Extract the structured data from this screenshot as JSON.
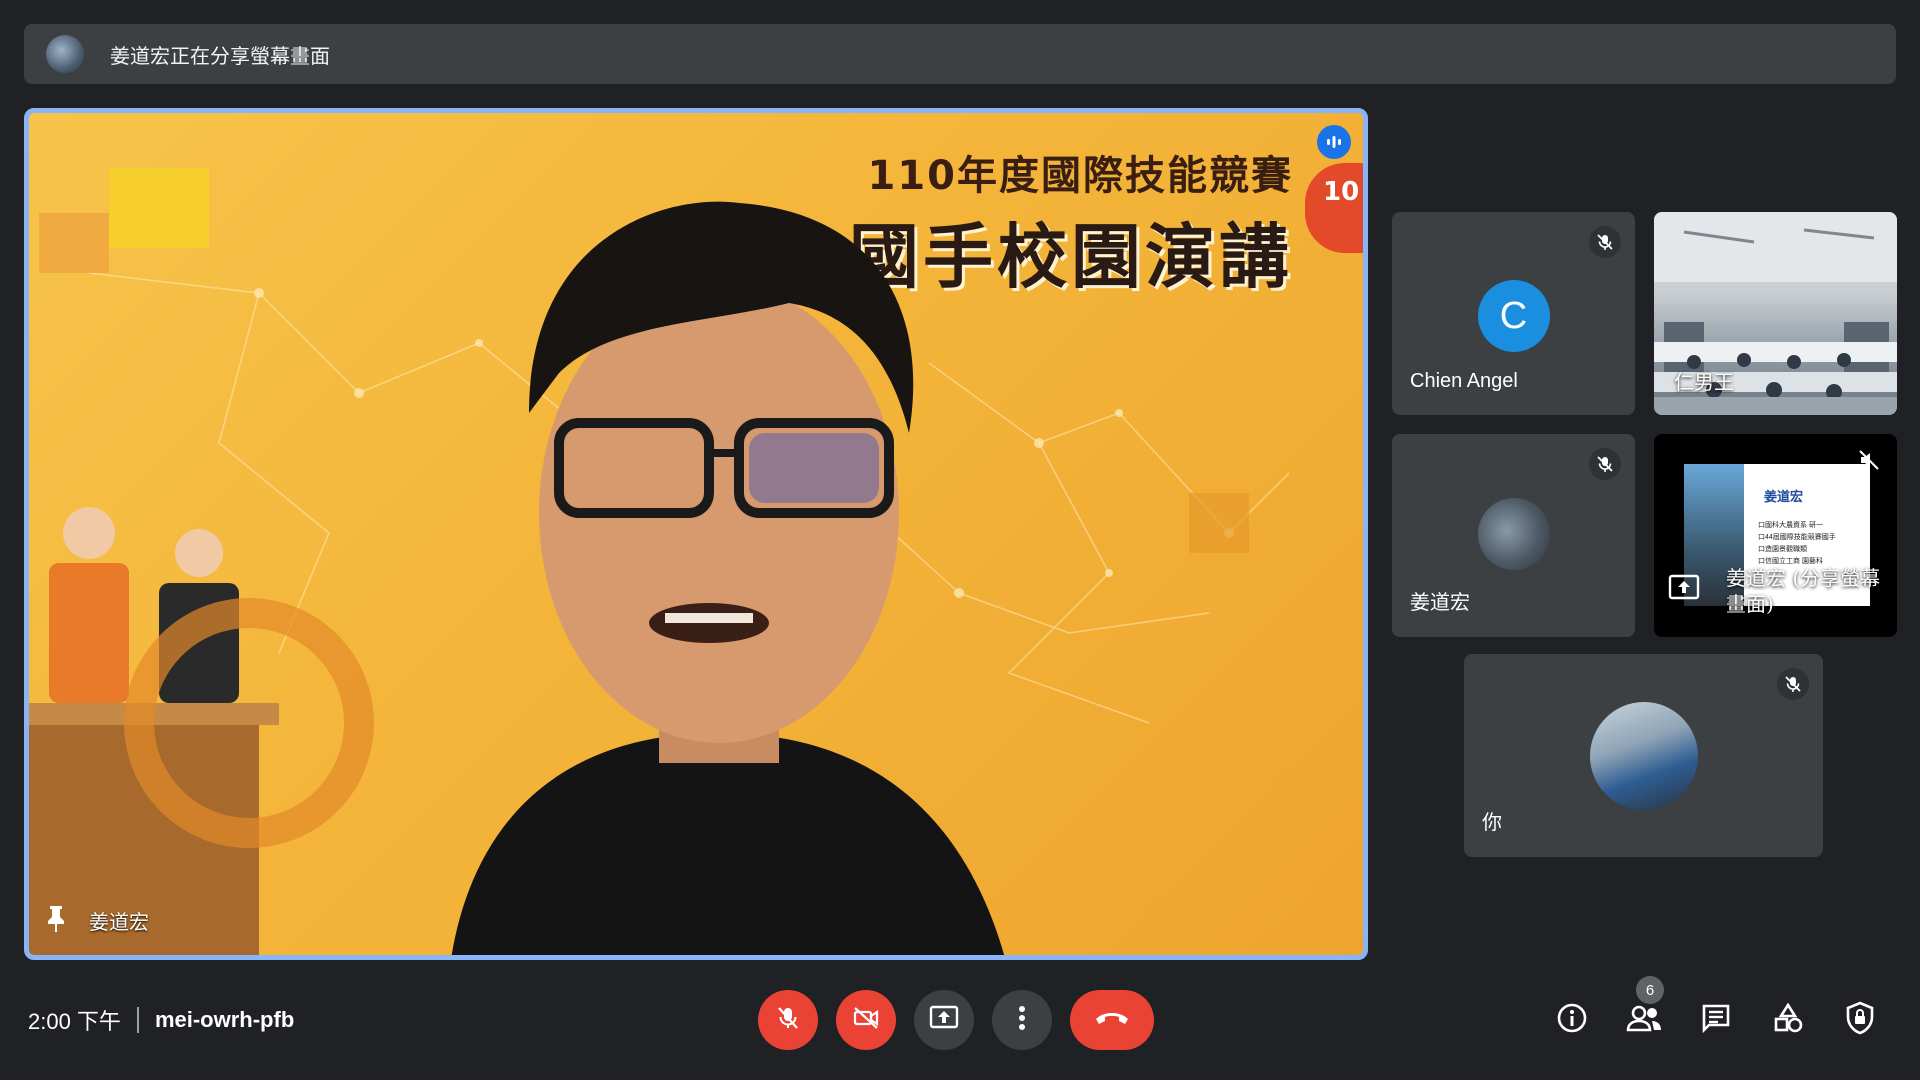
{
  "banner": {
    "text": "姜道宏正在分享螢幕畫面"
  },
  "main_tile": {
    "headline_line1": "110年度國際技能競賽",
    "headline_line2": "國手校園演講",
    "badge_text": "10",
    "pinned_name": "姜道宏"
  },
  "participants": [
    {
      "name": "Chien Angel",
      "avatar_letter": "C",
      "avatar_color": "#1a8fe0",
      "muted": true
    },
    {
      "name": "仁男王",
      "type": "camera"
    },
    {
      "name": "姜道宏",
      "muted": true
    },
    {
      "name": "姜道宏 (分享螢幕畫面)",
      "type": "presentation"
    },
    {
      "name": "你",
      "muted": true
    }
  ],
  "shared_slide": {
    "title": "姜道宏",
    "lines": [
      "口國科大農資系 研一",
      "口44屆國際技能競賽國手",
      "口造園景觀職類",
      "口信國立工商 園藝科"
    ]
  },
  "meeting": {
    "time": "2:00 下午",
    "code": "mei-owrh-pfb"
  },
  "toolbar": {
    "mic_icon": "mic-off-icon",
    "camera_icon": "videocam-off-icon",
    "present_icon": "present-screen-icon",
    "more_icon": "more-vert-icon",
    "end_icon": "call-end-icon"
  },
  "side_controls": {
    "participant_count": "6",
    "icons": [
      "info-icon",
      "people-icon",
      "chat-icon",
      "activities-icon",
      "host-controls-icon"
    ]
  },
  "colors": {
    "accent": "#8ab4f8",
    "danger": "#ea4335",
    "tile_bg": "#3c4043",
    "page_bg": "#202124"
  }
}
